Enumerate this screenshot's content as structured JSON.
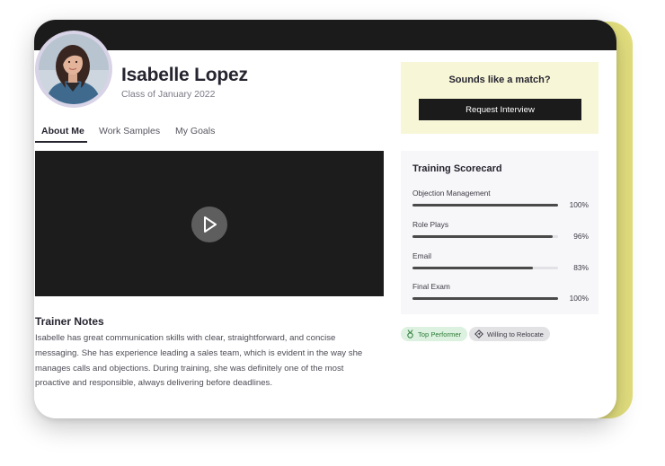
{
  "profile": {
    "name": "Isabelle Lopez",
    "subtitle": "Class of January 2022"
  },
  "tabs": [
    {
      "label": "About Me",
      "active": true
    },
    {
      "label": "Work Samples",
      "active": false
    },
    {
      "label": "My Goals",
      "active": false
    }
  ],
  "notes": {
    "title": "Trainer Notes",
    "body": "Isabelle has great communication skills with clear, straightforward, and concise messaging. She has experience leading a sales team, which is evident in the way she manages calls and objections. During training, she was definitely one of the most proactive and responsible, always delivering before deadlines."
  },
  "match": {
    "title": "Sounds like a match?",
    "button_label": "Request Interview"
  },
  "scorecard": {
    "title": "Training Scorecard",
    "items": [
      {
        "label": "Objection Management",
        "value": 100,
        "display": "100%"
      },
      {
        "label": "Role Plays",
        "value": 96,
        "display": "96%"
      },
      {
        "label": "Email",
        "value": 83,
        "display": "83%"
      },
      {
        "label": "Final Exam",
        "value": 100,
        "display": "100%"
      }
    ]
  },
  "badges": {
    "top_performer": "Top Performer",
    "relocate": "Willing to Relocate"
  },
  "colors": {
    "accent_yellow": "#e4e07f",
    "match_bg": "#f7f6d7",
    "dark": "#1b1b1b",
    "success_bg": "#dcf1df",
    "success_text": "#2e7d3a"
  },
  "icons": {
    "play": "play-icon",
    "top_performer": "medal-icon",
    "relocate": "compass-icon"
  }
}
